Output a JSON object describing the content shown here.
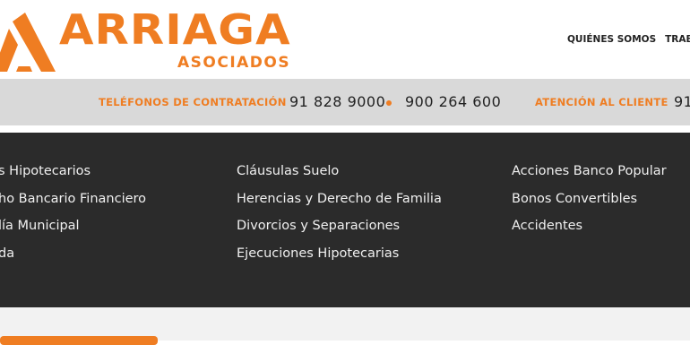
{
  "brand": {
    "name": "ARRIAGA",
    "subtitle": "ASOCIADOS",
    "color": "#ef7d22"
  },
  "topnav": {
    "items": [
      "QUIÉNES SOMOS",
      "TRABA"
    ]
  },
  "phonebar": {
    "contract_label": "TELÉFONOS DE CONTRATACIÓN",
    "phone_1": "91 828 9000",
    "phone_2": "900 264 600",
    "support_label": "ATENCIÓN AL CLIENTE",
    "support_phone": "91"
  },
  "menu": {
    "col1": [
      "s Hipotecarios",
      "ho Bancario Financiero",
      "lía Municipal",
      "da"
    ],
    "col2": [
      "Cláusulas Suelo",
      "Herencias y Derecho de Familia",
      "Divorcios y Separaciones",
      "Ejecuciones Hipotecarias"
    ],
    "col3": [
      "Acciones Banco Popular",
      "Bonos Convertibles",
      "Accidentes"
    ]
  }
}
